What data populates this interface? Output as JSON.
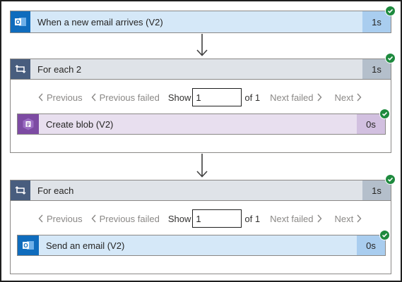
{
  "trigger": {
    "title": "When a new email arrives (V2)",
    "duration": "1s",
    "icon": "outlook-icon",
    "status": "succeeded"
  },
  "loops": [
    {
      "title": "For each 2",
      "duration": "1s",
      "pager": {
        "previous": "Previous",
        "previous_failed": "Previous failed",
        "show": "Show",
        "value": "1",
        "of": "of 1",
        "next_failed": "Next failed",
        "next": "Next"
      },
      "action": {
        "title": "Create blob (V2)",
        "duration": "0s",
        "icon": "blob-storage-icon"
      }
    },
    {
      "title": "For each",
      "duration": "1s",
      "pager": {
        "previous": "Previous",
        "previous_failed": "Previous failed",
        "show": "Show",
        "value": "1",
        "of": "of 1",
        "next_failed": "Next failed",
        "next": "Next"
      },
      "action": {
        "title": "Send an email (V2)",
        "duration": "0s",
        "icon": "outlook-icon"
      }
    }
  ],
  "colors": {
    "outlook": "#0f6cbd",
    "loop": "#485d7e",
    "blob": "#7d4ba3",
    "success": "#1e8a3e"
  }
}
